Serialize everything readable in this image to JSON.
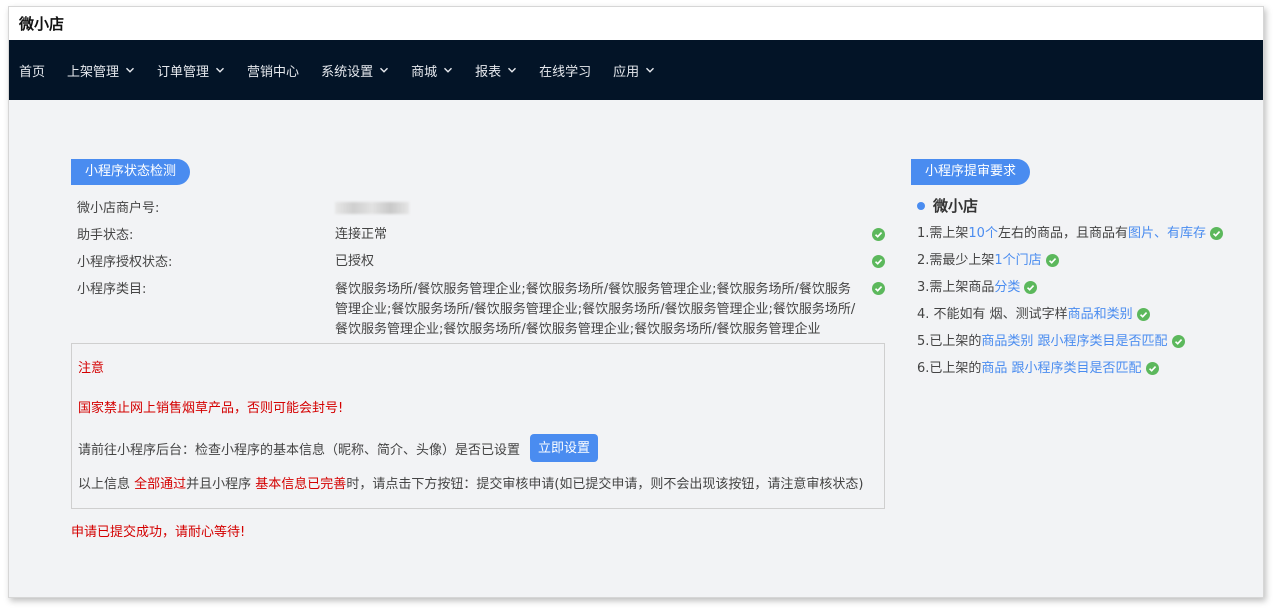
{
  "app": {
    "title": "微小店"
  },
  "nav": [
    {
      "label": "首页",
      "dropdown": false
    },
    {
      "label": "上架管理",
      "dropdown": true
    },
    {
      "label": "订单管理",
      "dropdown": true
    },
    {
      "label": "营销中心",
      "dropdown": false
    },
    {
      "label": "系统设置",
      "dropdown": true
    },
    {
      "label": "商城",
      "dropdown": true
    },
    {
      "label": "报表",
      "dropdown": true
    },
    {
      "label": "在线学习",
      "dropdown": false
    },
    {
      "label": "应用",
      "dropdown": true
    }
  ],
  "status": {
    "tag": "小程序状态检测",
    "rows": {
      "merchant": {
        "label": "微小店商户号:"
      },
      "assistant": {
        "label": "助手状态:",
        "value": "连接正常"
      },
      "auth": {
        "label": "小程序授权状态:",
        "value": "已授权"
      },
      "category": {
        "label": "小程序类目:",
        "value": "餐饮服务场所/餐饮服务管理企业;餐饮服务场所/餐饮服务管理企业;餐饮服务场所/餐饮服务管理企业;餐饮服务场所/餐饮服务管理企业;餐饮服务场所/餐饮服务管理企业;餐饮服务场所/餐饮服务管理企业;餐饮服务场所/餐饮服务管理企业;餐饮服务场所/餐饮服务管理企业"
      }
    }
  },
  "notice": {
    "title": "注意",
    "ban": "国家禁止网上销售烟草产品，否则可能会封号!",
    "check_text": "请前往小程序后台：检查小程序的基本信息（昵称、简介、头像）是否已设置",
    "set_button": "立即设置",
    "info_part1": "以上信息 ",
    "info_red1": "全部通过",
    "info_part2": "并且小程序 ",
    "info_red2": "基本信息已完善",
    "info_part3": "时，请点击下方按钮：提交审核申请(如已提交申请，则不会出现该按钮，请注意审核状态)"
  },
  "submitted": "申请已提交成功，请耐心等待!",
  "requirements": {
    "tag": "小程序提审要求",
    "store": "微小店",
    "items": [
      {
        "a": "1.需上架 ",
        "b": "10个",
        "c": "左右的商品，且商品有 ",
        "d": "图片、有库存"
      },
      {
        "a": "2.需最少上架 ",
        "b": "1个门店",
        "c": "",
        "d": ""
      },
      {
        "a": "3.需上架商品 ",
        "b": "分类",
        "c": "",
        "d": ""
      },
      {
        "a": "4. 不能如有 烟、测试字样 ",
        "b": "商品和类别",
        "c": "",
        "d": ""
      },
      {
        "a": "5.已上架的 ",
        "b": "商品类别 跟小程序类目是否匹配",
        "c": "",
        "d": ""
      },
      {
        "a": "6.已上架的 ",
        "b": "商品 跟小程序类目是否匹配",
        "c": "",
        "d": ""
      }
    ]
  },
  "colors": {
    "nav_bg": "#031427",
    "accent": "#4a8cf0",
    "ok": "#5cb85c",
    "warn": "#d40000"
  }
}
